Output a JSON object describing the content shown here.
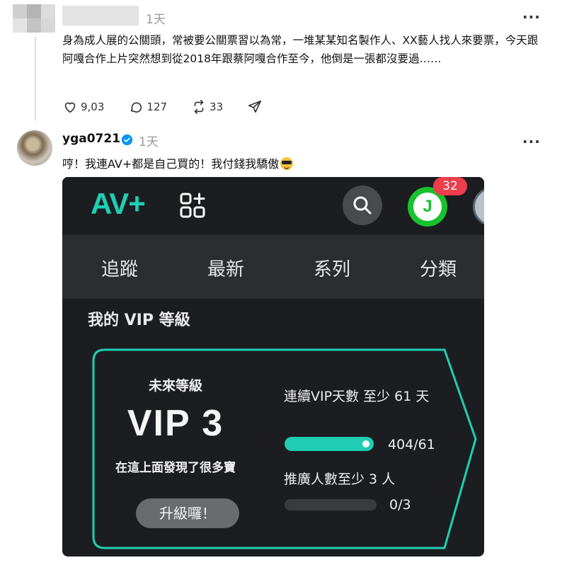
{
  "post1": {
    "time": "1天",
    "more_label": "···",
    "text": "身為成人展的公關頭，常被要公關票習以為常，一堆某某知名製作人、XX藝人找人來要票，今天跟阿嘎合作上片突然想到從2018年跟蔡阿嘎合作至今，他倒是一張都沒要過……",
    "likes": "9,03",
    "comments": "127",
    "reposts": "33",
    "icons": [
      "heart-icon",
      "comment-icon",
      "repost-icon",
      "share-icon"
    ]
  },
  "post2": {
    "username": "yga0721",
    "time": "1天",
    "more_label": "···",
    "text": "哼！我連AV+都是自己買的！我付錢我驕傲",
    "accent": "#0095f6"
  },
  "app": {
    "logo": "AV+",
    "notif_count": "32",
    "avatar_letter": "J",
    "tabs": [
      "追蹤",
      "最新",
      "系列",
      "分類"
    ],
    "section_title": "我的 VIP 等級",
    "future_label": "未來等級",
    "vip_level": "VIP 3",
    "discover_text": "在這上面發現了很多寶",
    "upgrade_label": "升級囉！",
    "req1_label": "連續VIP天數 至少 61 天",
    "req1_value": "404/61",
    "req1_progress": 1.0,
    "req2_label": "推廣人數至少 3 人",
    "req2_value": "0/3",
    "req2_progress": 0.0,
    "accent": "#1ecfb3"
  }
}
